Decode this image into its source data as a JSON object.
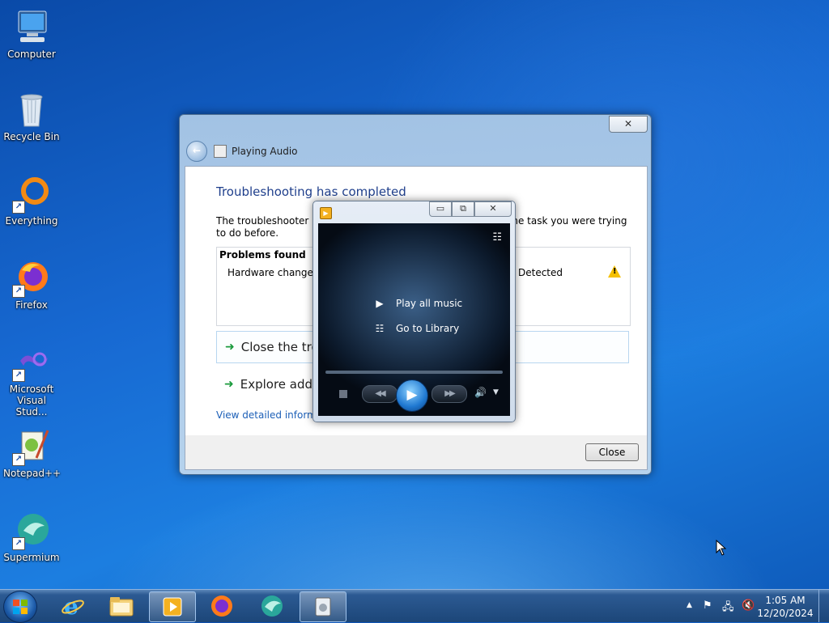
{
  "desktop": {
    "icons": [
      {
        "label": "Computer"
      },
      {
        "label": "Recycle Bin"
      },
      {
        "label": "Everything"
      },
      {
        "label": "Firefox"
      },
      {
        "label": "Microsoft Visual Stud..."
      },
      {
        "label": "Notepad++"
      },
      {
        "label": "Supermium"
      }
    ]
  },
  "troubleshooter": {
    "title": "Playing Audio",
    "close_glyph": "✕",
    "heading": "Troubleshooting has completed",
    "description": "The troubleshooter ma… the task you were trying to do before.",
    "description_left": "The troubleshooter ma",
    "description_right": "g the task you were trying",
    "description_line2": "to do before.",
    "problems_header": "Problems found",
    "problem_text": "Hardware changes r",
    "problem_status": "Detected",
    "option_close": "Close the tro",
    "option_explore": "Explore addi",
    "link_text": "View detailed informat",
    "close_button": "Close"
  },
  "media_player": {
    "play_all": "Play all music",
    "go_to_library": "Go to Library"
  },
  "taskbar": {
    "clock_time": "1:05 AM",
    "clock_date": "12/20/2024"
  },
  "colors": {
    "heading_blue": "#1f3f8c",
    "link_blue": "#1c5fb7",
    "green_arrow": "#1a9a3c",
    "warning_yellow": "#f5c000"
  }
}
